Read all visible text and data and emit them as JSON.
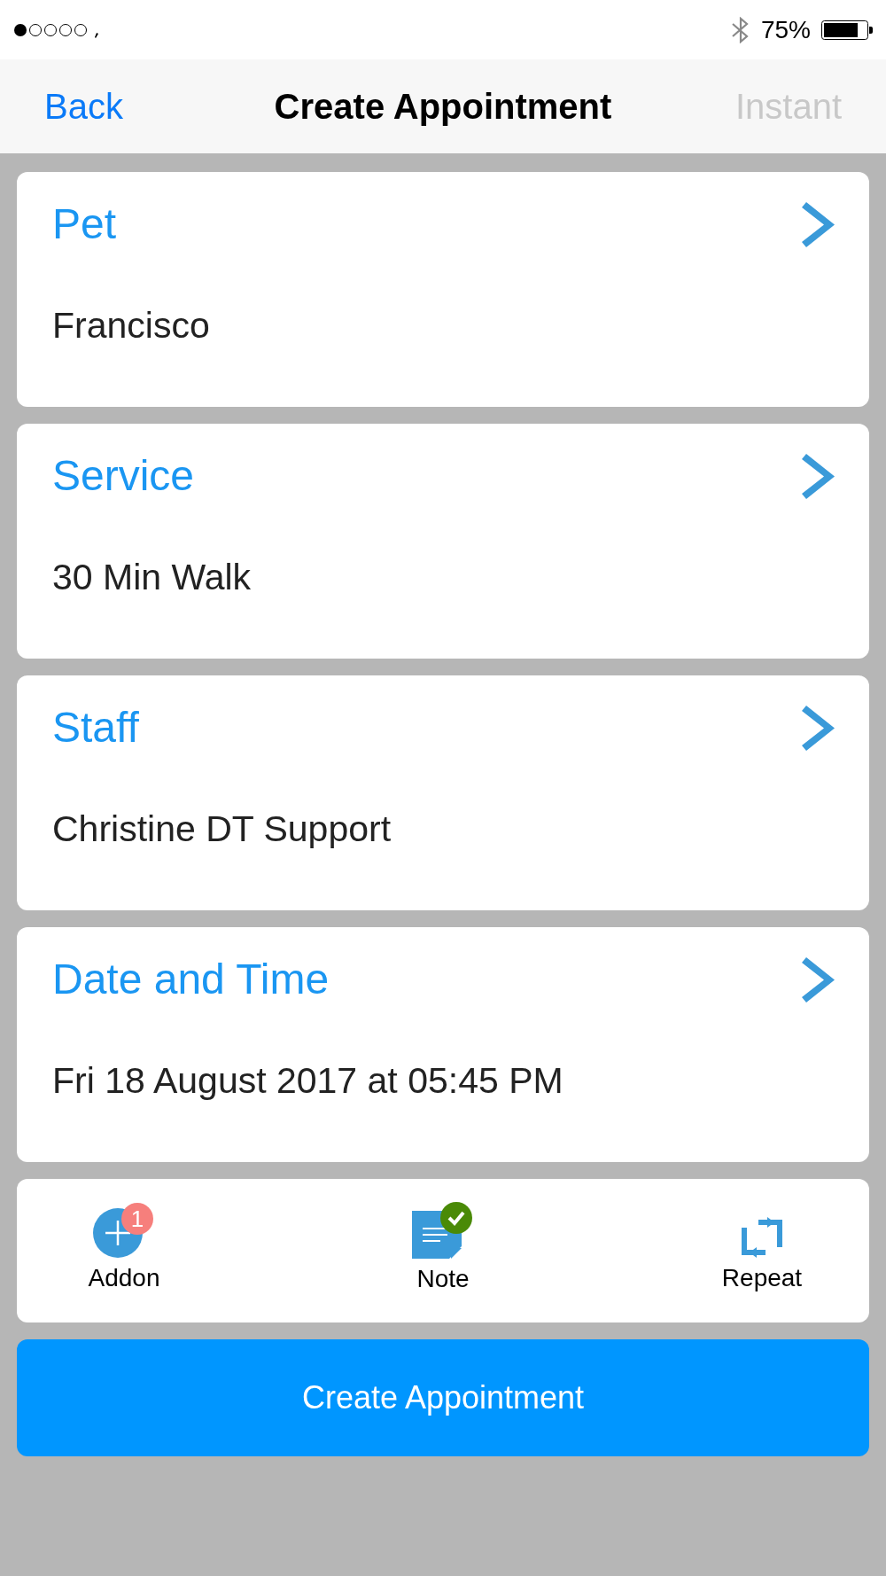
{
  "status_bar": {
    "battery": "75%"
  },
  "nav_bar": {
    "back": "Back",
    "title": "Create Appointment",
    "action": {
      "label": "Instant",
      "disabled": true
    }
  },
  "fields": [
    {
      "label": "Pet",
      "value": "Francisco"
    },
    {
      "label": "Service",
      "value": "30 Min Walk"
    },
    {
      "label": "Staff",
      "value": "Christine DT Support"
    },
    {
      "label": "Date and Time",
      "value": "Fri 18 August 2017 at 05:45 PM"
    }
  ],
  "actions": [
    {
      "kind": "addon",
      "label": "Addon",
      "badge": "1"
    },
    {
      "kind": "note",
      "label": "Note",
      "checked": true
    },
    {
      "kind": "repeat",
      "label": "Repeat"
    }
  ],
  "submit_button": "Create Appointment"
}
